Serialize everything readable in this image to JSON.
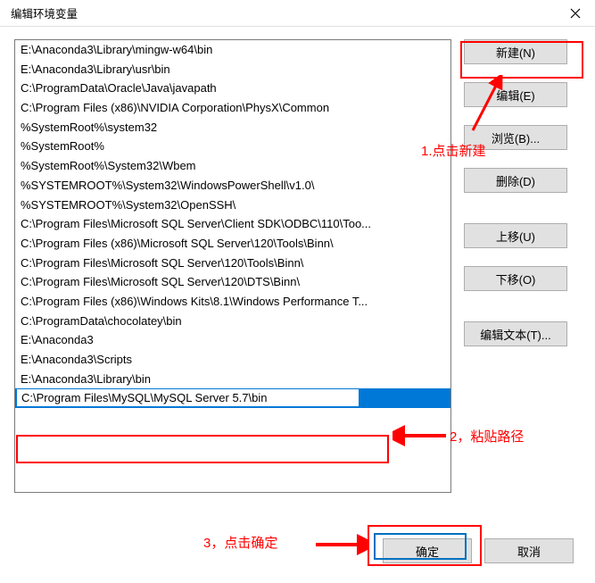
{
  "window": {
    "title": "编辑环境变量"
  },
  "paths": [
    "E:\\Anaconda3\\Library\\mingw-w64\\bin",
    "E:\\Anaconda3\\Library\\usr\\bin",
    "C:\\ProgramData\\Oracle\\Java\\javapath",
    "C:\\Program Files (x86)\\NVIDIA Corporation\\PhysX\\Common",
    "%SystemRoot%\\system32",
    "%SystemRoot%",
    "%SystemRoot%\\System32\\Wbem",
    "%SYSTEMROOT%\\System32\\WindowsPowerShell\\v1.0\\",
    "%SYSTEMROOT%\\System32\\OpenSSH\\",
    "C:\\Program Files\\Microsoft SQL Server\\Client SDK\\ODBC\\110\\Too...",
    "C:\\Program Files (x86)\\Microsoft SQL Server\\120\\Tools\\Binn\\",
    "C:\\Program Files\\Microsoft SQL Server\\120\\Tools\\Binn\\",
    "C:\\Program Files\\Microsoft SQL Server\\120\\DTS\\Binn\\",
    "C:\\Program Files (x86)\\Windows Kits\\8.1\\Windows Performance T...",
    "C:\\ProgramData\\chocolatey\\bin",
    "E:\\Anaconda3",
    "E:\\Anaconda3\\Scripts",
    "E:\\Anaconda3\\Library\\bin",
    "C:\\Program Files\\MySQL\\MySQL Server 5.7\\bin"
  ],
  "edit_value": "C:\\Program Files\\MySQL\\MySQL Server 5.7\\bin",
  "buttons": {
    "new": "新建(N)",
    "edit": "编辑(E)",
    "browse": "浏览(B)...",
    "delete": "删除(D)",
    "moveup": "上移(U)",
    "movedown": "下移(O)",
    "edittext": "编辑文本(T)..."
  },
  "bottom": {
    "ok": "确定",
    "cancel": "取消"
  },
  "annotations": {
    "step1": "1.点击新建",
    "step2": "2，粘贴路径",
    "step3": "3，点击确定"
  },
  "colors": {
    "annotation": "#ff0000",
    "ok_highlight": "#0070c0",
    "selection": "#0078d7"
  }
}
